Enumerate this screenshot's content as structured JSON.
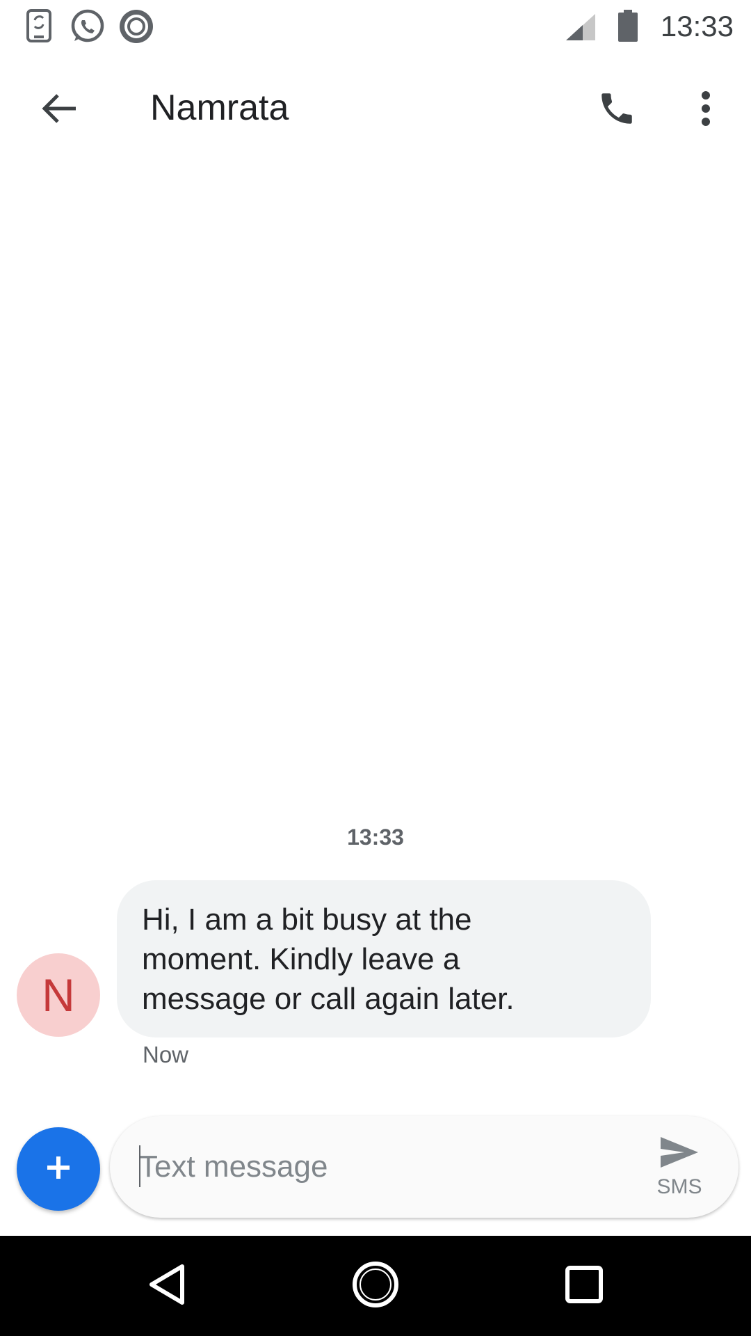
{
  "status_bar": {
    "time": "13:33",
    "icons": [
      "phone-sync-icon",
      "whatsapp-icon",
      "circle-app-icon",
      "signal-icon",
      "battery-icon"
    ]
  },
  "header": {
    "title": "Namrata",
    "actions": [
      "back-arrow-icon",
      "phone-icon",
      "more-vert-icon"
    ]
  },
  "conversation": {
    "timestamp": "13:33",
    "messages": [
      {
        "sender_initial": "N",
        "lines": [
          "Hi, I am a bit busy at the",
          "moment. Kindly leave a",
          "message or call again later."
        ],
        "status": "Now"
      }
    ]
  },
  "compose": {
    "placeholder": "Text message",
    "value": "",
    "send_label": "SMS"
  },
  "colors": {
    "accent": "#1a73e8",
    "avatar_bg": "#f8cfcf",
    "avatar_letter": "#c5393a",
    "bubble_bg": "#f1f3f4",
    "nav_bar": "#000000"
  },
  "nav_bar": {
    "buttons": [
      "back-triangle-icon",
      "home-circle-icon",
      "recents-square-icon"
    ]
  }
}
